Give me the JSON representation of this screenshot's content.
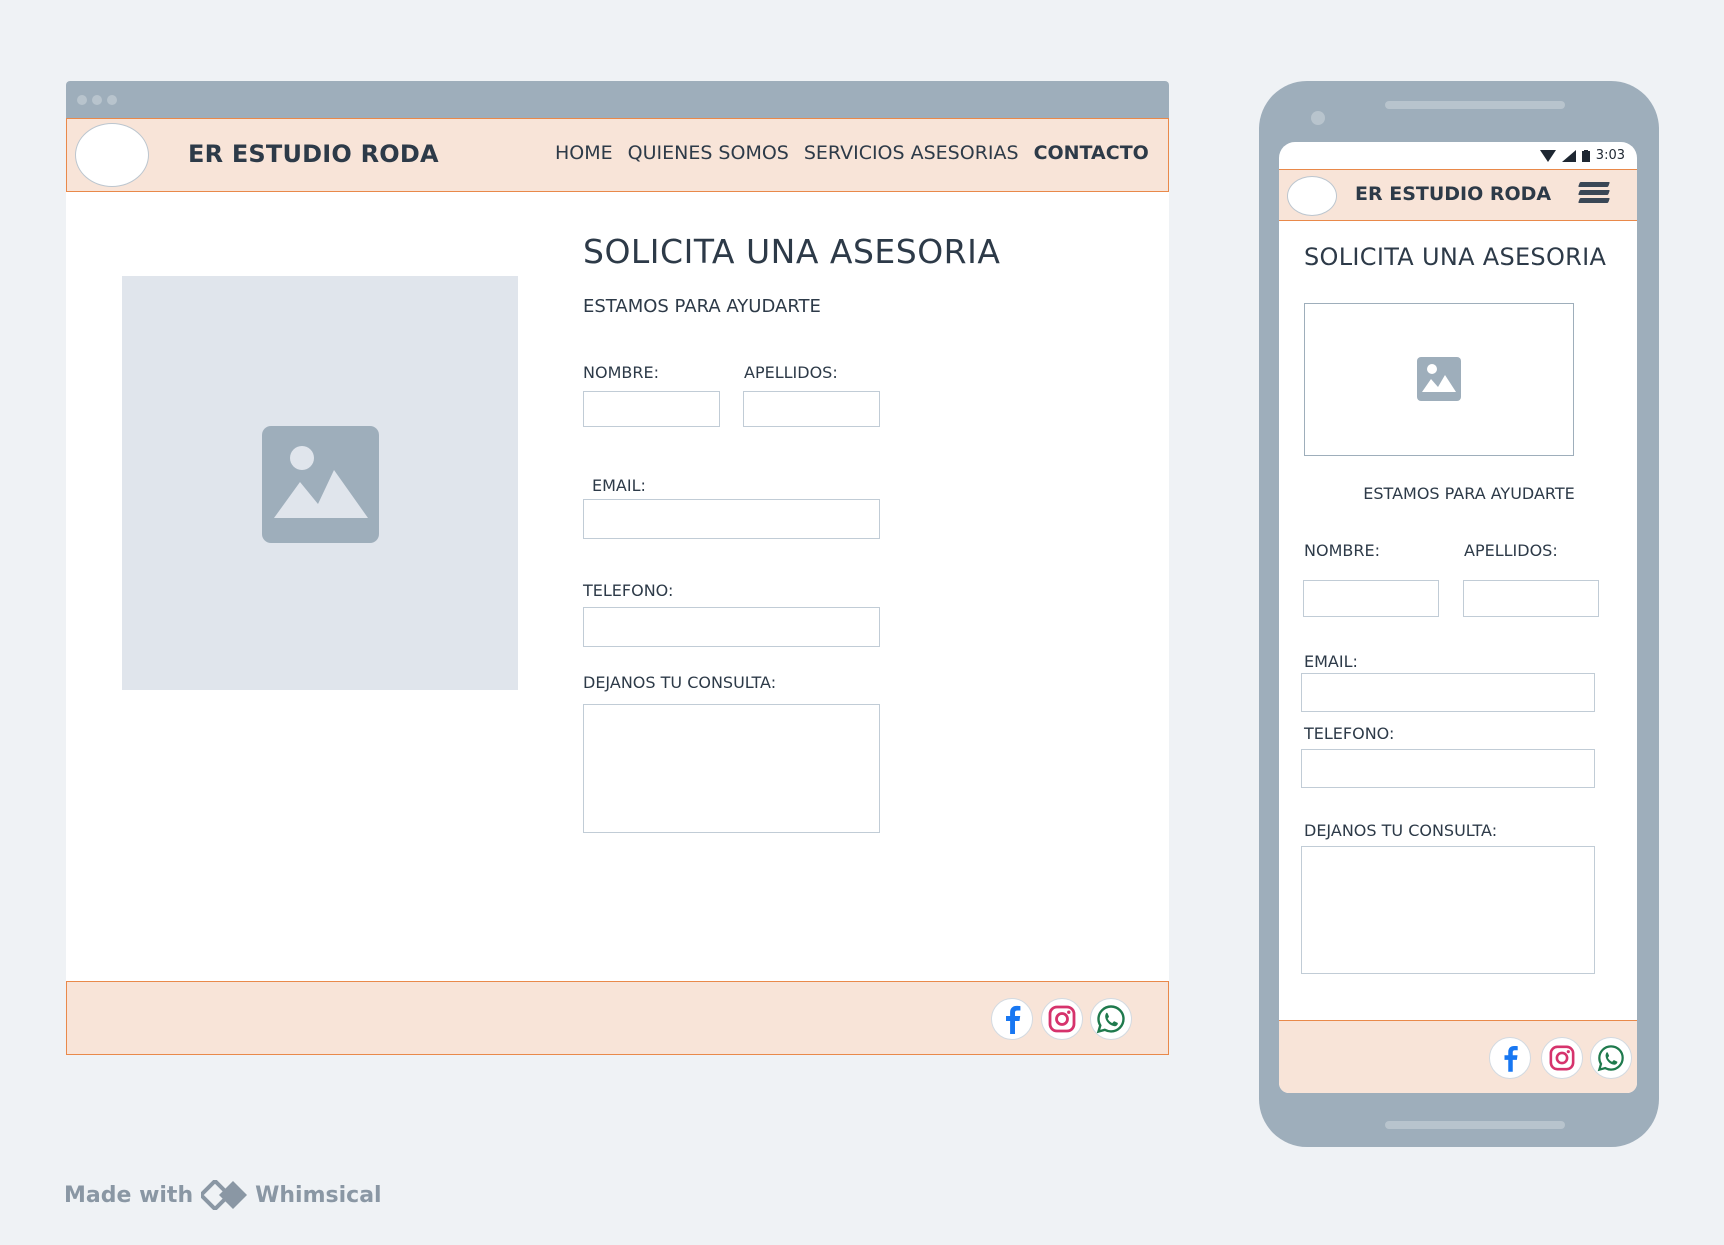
{
  "desktop": {
    "header": {
      "brand": "ER ESTUDIO RODA",
      "nav": [
        {
          "label": "HOME"
        },
        {
          "label": "QUIENES SOMOS"
        },
        {
          "label": "SERVICIOS ASESORIAS"
        },
        {
          "label": "CONTACTO",
          "active": true
        }
      ]
    },
    "main": {
      "title": "SOLICITA UNA ASESORIA",
      "subtitle": "ESTAMOS PARA AYUDARTE",
      "form": {
        "nombre_label": "NOMBRE:",
        "apellidos_label": "APELLIDOS:",
        "email_label": "EMAIL:",
        "telefono_label": "TELEFONO:",
        "consulta_label": "DEJANOS TU CONSULTA:"
      }
    },
    "footer": {
      "social": [
        "facebook-icon",
        "instagram-icon",
        "whatsapp-icon"
      ]
    }
  },
  "mobile": {
    "status": {
      "time": "3:03"
    },
    "header": {
      "brand": "ER ESTUDIO RODA",
      "menu_icon": "hamburger-icon"
    },
    "main": {
      "title": "SOLICITA UNA ASESORIA",
      "subtitle": "ESTAMOS PARA AYUDARTE",
      "form": {
        "nombre_label": "NOMBRE:",
        "apellidos_label": "APELLIDOS:",
        "email_label": "EMAIL:",
        "telefono_label": "TELEFONO:",
        "consulta_label": "DEJANOS TU CONSULTA:"
      }
    },
    "footer": {
      "social": [
        "facebook-icon",
        "instagram-icon",
        "whatsapp-icon"
      ]
    }
  },
  "watermark": {
    "made_with": "Made with",
    "brand": "Whimsical"
  },
  "colors": {
    "background": "#eff2f5",
    "header_bg": "#f8e4d8",
    "header_border": "#e9894a",
    "frame": "#9eaebb",
    "placeholder": "#e0e5ec",
    "text": "#2d3a48",
    "facebook": "#1877f2",
    "instagram": "#d6336c",
    "whatsapp": "#1f7a4d"
  }
}
